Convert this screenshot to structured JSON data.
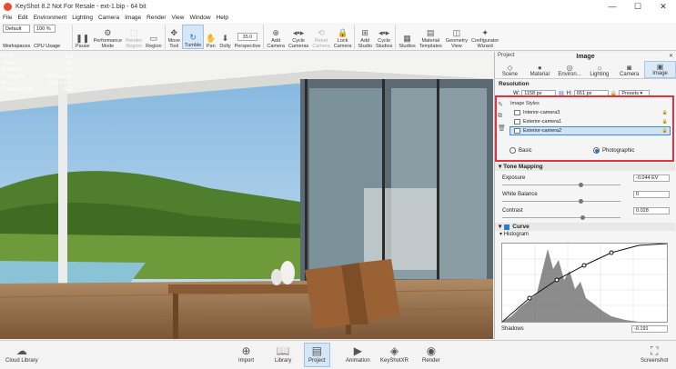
{
  "window": {
    "title": "KeyShot 8.2 Not For Resale - ext-1.bip - 64 bit",
    "minimize": "—",
    "maximize": "☐",
    "close": "✕"
  },
  "menu": [
    "File",
    "Edit",
    "Environment",
    "Lighting",
    "Camera",
    "Image",
    "Render",
    "View",
    "Window",
    "Help"
  ],
  "toolbar": {
    "workspace_value": "Default",
    "zoom_value": "100 %",
    "workspaces": "Workspaces",
    "cpu_usage": "CPU Usage",
    "pause": "Pause",
    "performance_mode": "Performance\nMode",
    "render_region": "Render\nRegion",
    "region": "Region",
    "move_tool": "Move\nTool",
    "tumble": "Tumble",
    "pan": "Pan",
    "dolly": "Dolly",
    "perspective_value": "35.0",
    "perspective": "Perspective",
    "add_camera": "Add\nCamera",
    "cycle_cameras": "Cycle\nCameras",
    "reset_camera": "Reset\nCamera",
    "lock_camera": "Lock\nCamera",
    "add_studio": "Add\nStudio",
    "cycle_studios": "Cycle\nStudios",
    "studios": "Studios",
    "material_templates": "Material\nTemplates",
    "geometry_view": "Geometry\nView",
    "configurator_wizard": "Configurator\nWizard"
  },
  "stats": [
    {
      "label": "FPS:",
      "value": "8.8"
    },
    {
      "label": "Time:",
      "value": "6s"
    },
    {
      "label": "Samples:",
      "value": "21"
    },
    {
      "label": "Triangles:",
      "value": "35,784,186"
    },
    {
      "label": "Res:",
      "value": "1158 x 651"
    },
    {
      "label": "Focal Length:",
      "value": "35.0"
    }
  ],
  "panel": {
    "project_label": "Project",
    "title": "Image",
    "tabs": [
      {
        "label": "Scene",
        "icon": "◇"
      },
      {
        "label": "Material",
        "icon": "●"
      },
      {
        "label": "Environ...",
        "icon": "◎"
      },
      {
        "label": "Lighting",
        "icon": "☼"
      },
      {
        "label": "Camera",
        "icon": "◙"
      },
      {
        "label": "Image",
        "icon": "▣"
      }
    ],
    "resolution_title": "Resolution",
    "w_label": "W:",
    "w_value": "1158 px",
    "h_label": "H:",
    "h_value": "651 px",
    "presets": "Presets",
    "image_styles_header": "Image Styles",
    "styles": [
      "Interior-camera3",
      "Exterior-camera1",
      "Exterior-camera2"
    ],
    "mode_basic": "Basic",
    "mode_photographic": "Photographic",
    "tone_mapping": "Tone Mapping",
    "exposure_label": "Exposure",
    "exposure_value": "-0.044 EV",
    "white_balance_label": "White Balance",
    "white_balance_value": "0",
    "contrast_label": "Contrast",
    "contrast_value": "0.028",
    "curve_title": "Curve",
    "histogram_label": "Histogram",
    "shadows_label": "Shadows",
    "shadows_value": "-0.191"
  },
  "bottom": {
    "cloud_library": "Cloud Library",
    "import": "Import",
    "library": "Library",
    "project": "Project",
    "animation": "Animation",
    "keyshotxr": "KeyShotXR",
    "render": "Render",
    "screenshot": "Screenshot"
  }
}
